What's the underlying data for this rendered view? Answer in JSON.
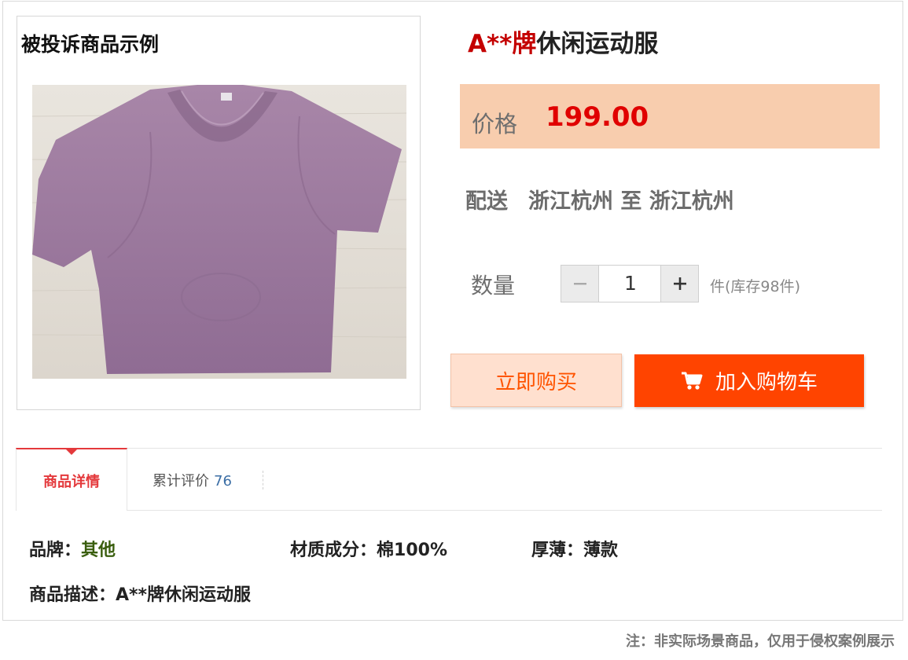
{
  "gallery": {
    "title": "被投诉商品示例"
  },
  "product": {
    "brand": "A**牌",
    "name": "休闲运动服"
  },
  "price": {
    "label": "价格",
    "value": "199.00"
  },
  "shipping": {
    "label": "配送",
    "route": "浙江杭州 至 浙江杭州"
  },
  "quantity": {
    "label": "数量",
    "minus": "−",
    "value": "1",
    "plus": "+",
    "stock": "件(库存98件)"
  },
  "actions": {
    "buy_now": "立即购买",
    "add_to_cart": "加入购物车"
  },
  "tabs": [
    {
      "label": "商品详情",
      "active": true
    },
    {
      "label": "累计评价",
      "count": "76"
    }
  ],
  "attributes": {
    "brand_label": "品牌：",
    "brand_value": "其他",
    "material_label": "材质成分：",
    "material_value": "棉100%",
    "thickness_label": "厚薄：",
    "thickness_value": "薄款",
    "desc_label": "商品描述：",
    "desc_value": "A**牌休闲运动服"
  },
  "footnote": "注：非实际场景商品，仅用于侵权案例展示",
  "colors": {
    "accent_red": "#e00000",
    "cart_orange": "#ff4400",
    "price_bg": "#f8cdae",
    "shirt": "#9d7a9d"
  }
}
